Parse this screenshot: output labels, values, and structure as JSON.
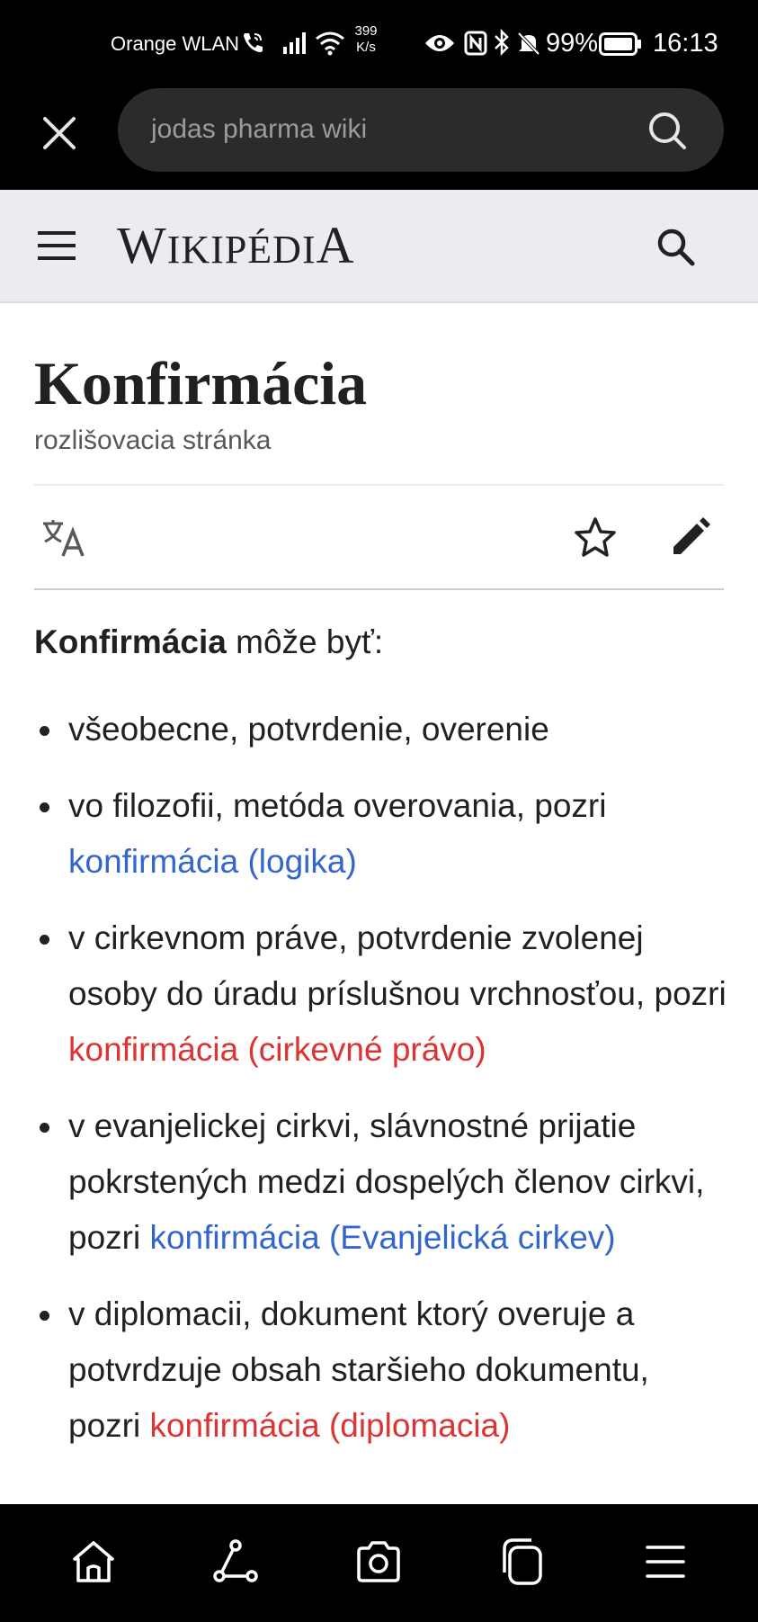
{
  "status_bar": {
    "carrier": "Orange WLAN",
    "net_speed_value": "399",
    "net_speed_unit": "K/s",
    "battery": "99%",
    "time": "16:13"
  },
  "browser": {
    "search_query": "jodas pharma wiki"
  },
  "wiki": {
    "wordmark_first": "W",
    "wordmark_middle": "IKIPÉDI",
    "wordmark_last": "A",
    "title": "Konfirmácia",
    "subtitle": "rozlišovacia stránka",
    "intro_bold": "Konfirmácia",
    "intro_rest": " môže byť:",
    "items": [
      {
        "text": "všeobecne, potvrdenie, overenie"
      },
      {
        "text": "vo filozofii, metóda overovania, pozri ",
        "link": "konfirmácia (logika)",
        "link_color": "blue"
      },
      {
        "text": "v cirkevnom práve, potvrdenie zvolenej osoby do úradu príslušnou vrchnosťou, pozri ",
        "link": "konfirmácia (cirkevné právo)",
        "link_color": "red"
      },
      {
        "text": "v evanjelickej cirkvi, slávnostné prijatie pokrstených medzi dospelých členov cirkvi, pozri ",
        "link": "konfirmácia (Evanjelická cirkev)",
        "link_color": "blue"
      },
      {
        "text": "v diplomacii, dokument ktorý overuje a potvrdzuje obsah staršieho dokumentu, pozri ",
        "link": "konfirmácia (diplomacia)",
        "link_color": "red"
      }
    ]
  },
  "colors": {
    "link_blue": "#3366cc",
    "link_red": "#dd3333",
    "header_bg": "#eaecf0"
  },
  "icons": {
    "status": [
      "wifi-calling-icon",
      "signal-icon",
      "wifi-icon",
      "eye-icon",
      "nfc-icon",
      "bluetooth-icon",
      "mute-icon",
      "battery-icon"
    ],
    "nav": [
      "home-icon",
      "share-icon",
      "camera-icon",
      "tabs-icon",
      "menu-icon"
    ]
  }
}
